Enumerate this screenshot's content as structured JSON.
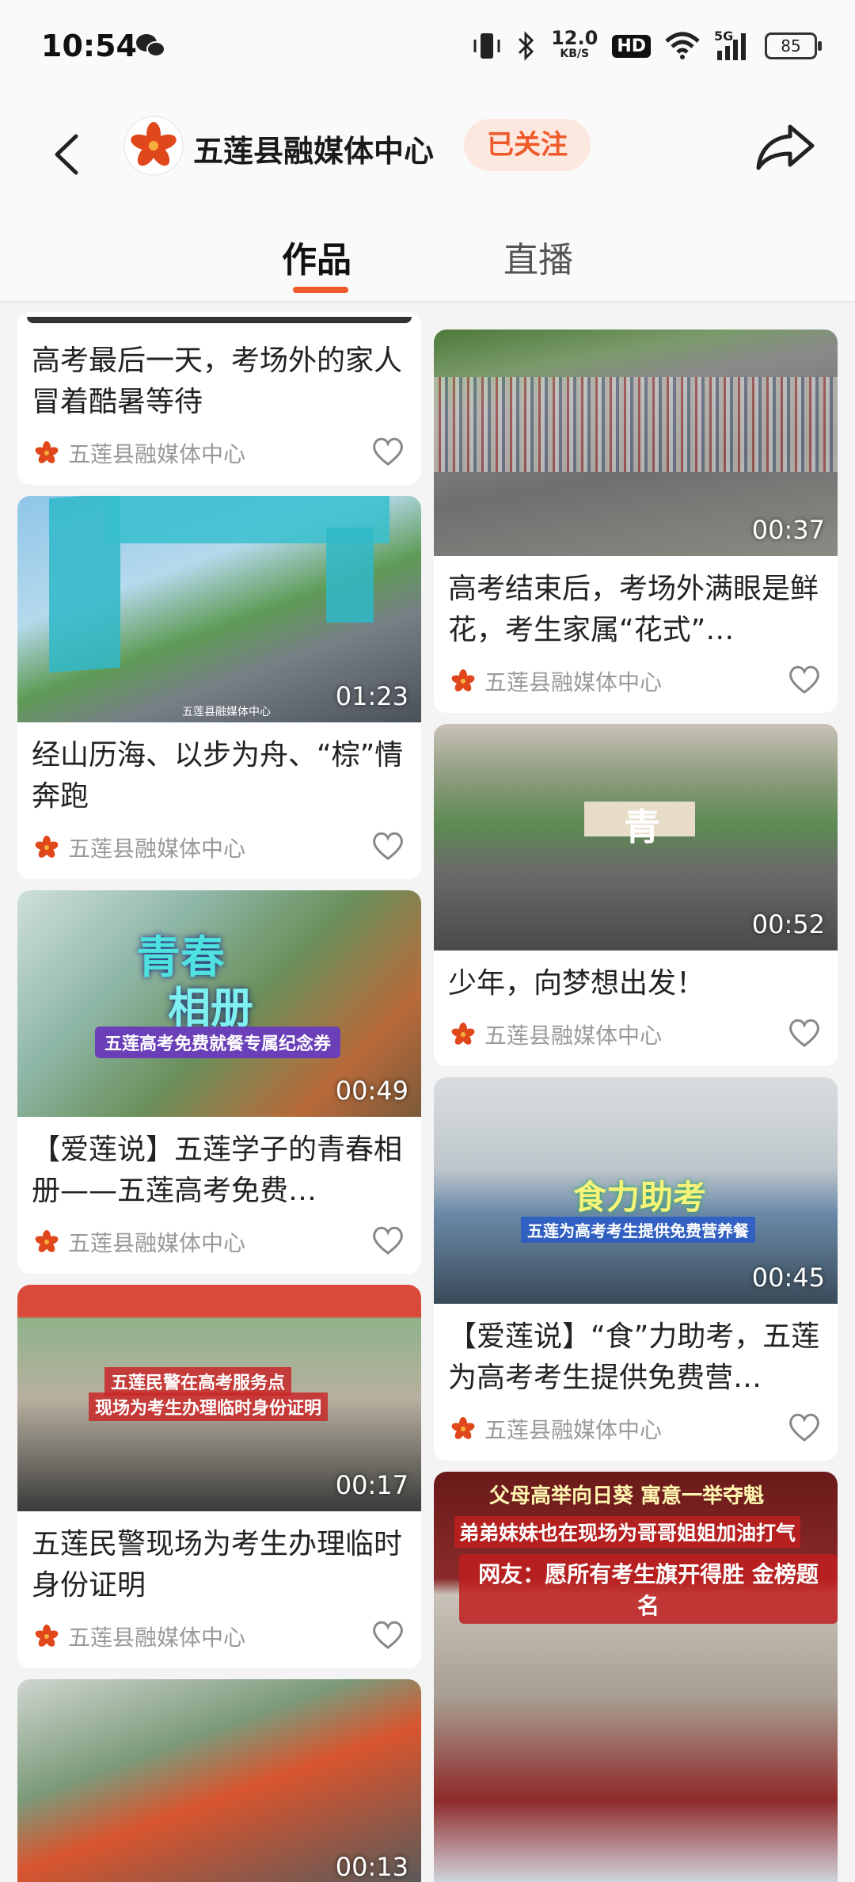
{
  "status_bar": {
    "time": "10:54",
    "speed_value": "12.0",
    "speed_unit": "KB/S",
    "hd": "HD",
    "signal_label": "5G",
    "battery": "85"
  },
  "header": {
    "channel_name": "五莲县融媒体中心",
    "follow_label": "已关注"
  },
  "tabs": [
    {
      "label": "作品",
      "active": true
    },
    {
      "label": "直播",
      "active": false
    }
  ],
  "feed_left": [
    {
      "title": "高考最后一天，考场外的家人冒着酷暑等待",
      "source": "五莲县融媒体中心",
      "duration": ""
    },
    {
      "title": "经山历海、以步为舟、“棕”情奔跑",
      "source": "五莲县融媒体中心",
      "duration": "01:23",
      "thumb_caption": "五莲县融媒体中心"
    },
    {
      "title": "【爱莲说】五莲学子的青春相册——五莲高考免费…",
      "source": "五莲县融媒体中心",
      "duration": "00:49",
      "thumb_title": "青春",
      "thumb_subtitle": "相册",
      "thumb_banner": "五莲高考免费就餐专属纪念券"
    },
    {
      "title": "五莲民警现场为考生办理临时身份证明",
      "source": "五莲县融媒体中心",
      "duration": "00:17",
      "thumb_line1": "五莲民警在高考服务点",
      "thumb_line2": "现场为考生办理临时身份证明"
    },
    {
      "title": "",
      "source": "",
      "duration": "00:13"
    }
  ],
  "feed_right": [
    {
      "title": "高考结束后，考场外满眼是鲜花，考生家属“花式”…",
      "source": "五莲县融媒体中心",
      "duration": "00:37"
    },
    {
      "title": "少年，向梦想出发！",
      "source": "五莲县融媒体中心",
      "duration": "00:52",
      "thumb_sign": "青"
    },
    {
      "title": "【爱莲说】“食”力助考，五莲为高考考生提供免费营…",
      "source": "五莲县融媒体中心",
      "duration": "00:45",
      "thumb_title": "食力助考",
      "thumb_banner": "五莲为高考考生提供免费营养餐"
    },
    {
      "title": "",
      "source": "",
      "duration": "",
      "thumb_line1": "父母高举向日葵 寓意一举夺魁",
      "thumb_line2": "弟弟妹妹也在现场为哥哥姐姐加油打气",
      "thumb_line3": "网友：愿所有考生旗开得胜 金榜题名"
    }
  ],
  "colors": {
    "accent": "#ef5a2a",
    "follow_bg": "#fde8e0",
    "background": "#f4f4f4"
  }
}
